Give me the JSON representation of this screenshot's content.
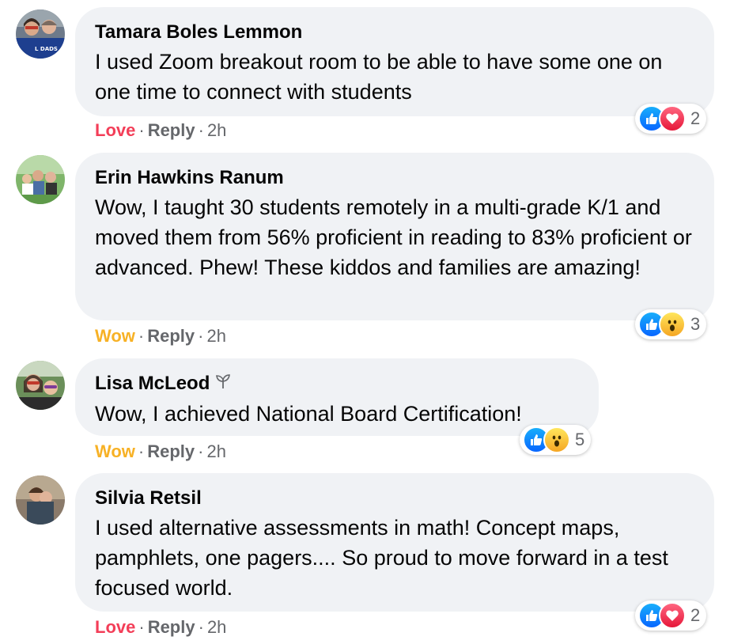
{
  "comments": [
    {
      "author": "Tamara Boles Lemmon",
      "text": "I used Zoom breakout room to be able to have some one on one time to connect with students",
      "reaction_label": "Love",
      "reply_label": "Reply",
      "time": "2h",
      "reaction_icons": [
        "like-icon",
        "love-icon"
      ],
      "reaction_count": "2",
      "avatar_shirt_text": "L DADS"
    },
    {
      "author": "Erin Hawkins Ranum",
      "text": "Wow, I taught 30 students remotely in a multi-grade K/1 and moved them from 56% proficient in reading to 83% proficient or advanced. Phew! These kiddos and families are amazing!",
      "reaction_label": "Wow",
      "reply_label": "Reply",
      "time": "2h",
      "reaction_icons": [
        "like-icon",
        "wow-icon"
      ],
      "reaction_count": "3"
    },
    {
      "author": "Lisa McLeod",
      "author_badge": "sprout-icon",
      "text": "Wow, I achieved National Board Certification!",
      "reaction_label": "Wow",
      "reply_label": "Reply",
      "time": "2h",
      "reaction_icons": [
        "like-icon",
        "wow-icon"
      ],
      "reaction_count": "5"
    },
    {
      "author": "Silvia Retsil",
      "text": "I used alternative assessments in math! Concept maps, pamphlets, one pagers.... So proud to move forward in a test focused world.",
      "reaction_label": "Love",
      "reply_label": "Reply",
      "time": "2h",
      "reaction_icons": [
        "like-icon",
        "love-icon"
      ],
      "reaction_count": "2"
    }
  ],
  "colors": {
    "bubble_bg": "#f0f2f5",
    "love": "#f33e58",
    "wow": "#f7b125",
    "meta_gray": "#65676b",
    "like_blue": "#0866ff"
  }
}
